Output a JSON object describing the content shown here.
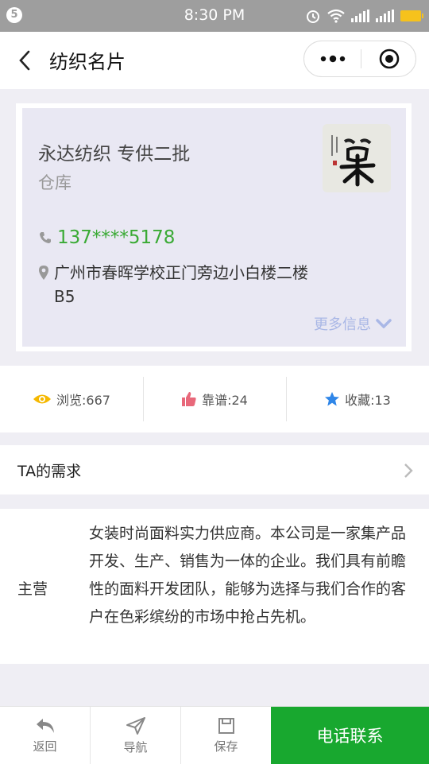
{
  "status": {
    "time": "8:30 PM",
    "notif_badge": "5"
  },
  "nav": {
    "title": "纺织名片"
  },
  "card": {
    "name": "永达纺织 专供二批",
    "subtitle": "仓库",
    "phone": "137****5178",
    "address": "广州市春晖学校正门旁边小白楼二楼B5",
    "more_info": "更多信息"
  },
  "stats": {
    "views": "浏览:667",
    "reliable": "靠谱:24",
    "favorites": "收藏:13"
  },
  "needs": {
    "label": "TA的需求"
  },
  "main_business": {
    "label": "主营",
    "text": "女装时尚面料实力供应商。本公司是一家集产品开发、生产、销售为一体的企业。我们具有前瞻性的面料开发团队，能够为选择与我们合作的客户在色彩缤纷的市场中抢占先机。"
  },
  "bottom": {
    "back": "返回",
    "navigate": "导航",
    "save": "保存",
    "call": "电话联系"
  },
  "colors": {
    "accent_green": "#18a82f",
    "phone_green": "#3aaa35",
    "link_blue": "#a9b7e6"
  },
  "icons": [
    "back-icon",
    "more-icon",
    "target-icon",
    "phone-icon",
    "location-icon",
    "chevron-down-icon",
    "eye-icon",
    "thumbs-up-icon",
    "star-icon",
    "chevron-right-icon",
    "reply-icon",
    "navigation-icon",
    "save-icon"
  ]
}
